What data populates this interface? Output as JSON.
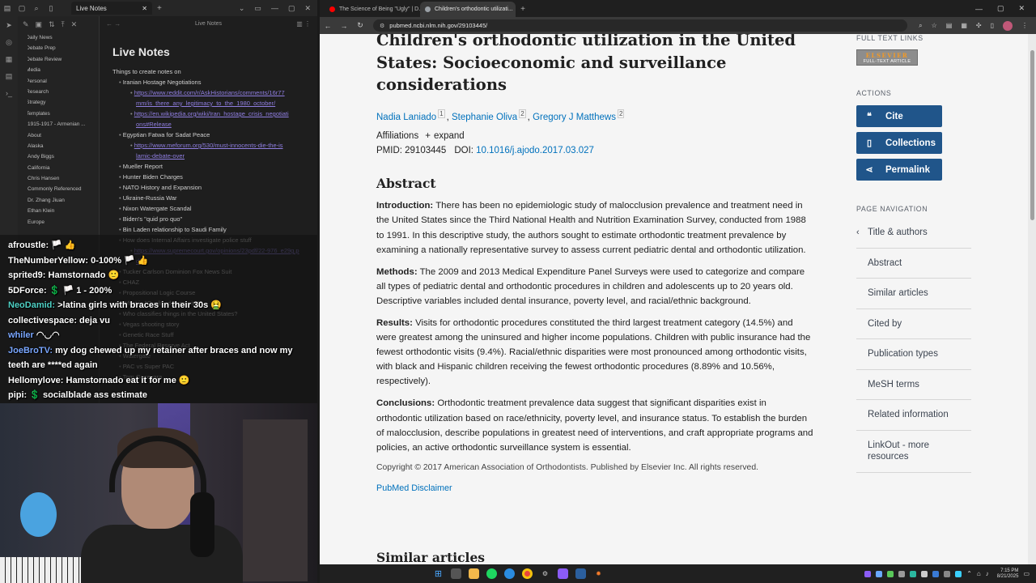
{
  "obsidian": {
    "tab_title": "Live Notes",
    "editor_header": "Live Notes",
    "note_title": "Live Notes",
    "tree": [
      {
        "label": "Daily News",
        "folder": true
      },
      {
        "label": "Debate Prep",
        "folder": true
      },
      {
        "label": "Debate Review",
        "folder": true
      },
      {
        "label": "Media",
        "folder": true
      },
      {
        "label": "Personal",
        "folder": true
      },
      {
        "label": "Research",
        "folder": true
      },
      {
        "label": "Strategy",
        "folder": true
      },
      {
        "label": "Templates",
        "folder": true
      },
      {
        "label": "1915-1917 - Armenian ...",
        "folder": false
      },
      {
        "label": "About",
        "folder": false
      },
      {
        "label": "Alaska",
        "folder": false
      },
      {
        "label": "Andy Biggs",
        "folder": false
      },
      {
        "label": "California",
        "folder": false
      },
      {
        "label": "Chris Hansen",
        "folder": false
      },
      {
        "label": "Commonly Referenced",
        "folder": false
      },
      {
        "label": "Dr. Zhang Jiuan",
        "folder": false
      },
      {
        "label": "Ethan Klein",
        "folder": false
      },
      {
        "label": "Europe",
        "folder": false
      }
    ],
    "lines": [
      {
        "level": 0,
        "text": "Things to create notes on"
      },
      {
        "level": 1,
        "text": "Iranian Hostage Negotiations"
      },
      {
        "level": 2,
        "text": "https://www.reddit.com/r/AskHistorians/comments/16r77",
        "link": true
      },
      {
        "level": 3,
        "text": "mm/is_there_any_legitimacy_to_the_1980_october/",
        "link": true
      },
      {
        "level": 2,
        "text": "https://en.wikipedia.org/wiki/Iran_hostage_crisis_negotiati",
        "link": true
      },
      {
        "level": 3,
        "text": "ons#Release",
        "link": true
      },
      {
        "level": 1,
        "text": "Egyptian Fatwa for Sadat Peace"
      },
      {
        "level": 2,
        "text": "https://www.meforum.org/530/must-innocents-die-the-is",
        "link": true
      },
      {
        "level": 3,
        "text": "lamic-debate-over",
        "link": true
      },
      {
        "level": 1,
        "text": "Mueller Report"
      },
      {
        "level": 1,
        "text": "Hunter Biden Charges"
      },
      {
        "level": 1,
        "text": "NATO History and Expansion"
      },
      {
        "level": 1,
        "text": "Ukraine-Russia War"
      },
      {
        "level": 1,
        "text": "Nixon Watergate Scandal"
      },
      {
        "level": 1,
        "text": "Biden's \"quid pro quo\""
      },
      {
        "level": 1,
        "text": "Bin Laden relationship to Saudi Family"
      },
      {
        "level": 1,
        "text": "How does Internal Affairs investigate police stuff"
      },
      {
        "level": 2,
        "text": "https://www.supremecourt.gov/opinions/23pdf/22-976_e29g.p",
        "link": true
      },
      {
        "level": 3,
        "text": "df",
        "link": true
      },
      {
        "level": 1,
        "text": "Tucker Carlson Dominion Fox News Suit"
      },
      {
        "level": 1,
        "text": "CHAZ"
      },
      {
        "level": 1,
        "text": "Propositional Logic Course"
      },
      {
        "level": 1,
        "text": "What is \"Qualified Immunity\"?"
      },
      {
        "level": 1,
        "text": "Who classifies things in the United States?"
      },
      {
        "level": 1,
        "text": "Vegas shooting story"
      },
      {
        "level": 1,
        "text": "Genetic Race Stuff"
      },
      {
        "level": 1,
        "text": "The Federal Reserve Act"
      },
      {
        "level": 1,
        "text": "Watergate"
      },
      {
        "level": 1,
        "text": "PAC vs Super PAC"
      },
      {
        "level": 1,
        "text": "Tom Gasevara"
      }
    ]
  },
  "chat": [
    {
      "user": "afroustle:",
      "msg": " 🏳️ 👍",
      "color": "white"
    },
    {
      "user": "TheNumberYellow:",
      "msg": " 0-100% 🏳️ 👍",
      "color": "white"
    },
    {
      "user": "sprited9:",
      "msg": " Hamstornado 🙂",
      "color": "white"
    },
    {
      "user": "5DForce:",
      "msg": " 💲 🏳️ 1 - 200%",
      "color": "white"
    },
    {
      "user": "NeoDamid:",
      "msg": " >latina girls with braces in their 30s 🤮",
      "color": "teal"
    },
    {
      "user": "collectivespace:",
      "msg": " deja vu",
      "color": "white"
    },
    {
      "user": "whiler",
      "msg": " ◠◡◠",
      "color": "blue"
    },
    {
      "user": "JoeBroTV:",
      "msg": " my dog chewed up my retainer after braces and now my",
      "color": "blue"
    },
    {
      "user": "",
      "msg": "teeth are ****ed again",
      "color": "white"
    },
    {
      "user": "Hellomylove:",
      "msg": " Hamstornado eat it for me 🙂",
      "color": "white"
    },
    {
      "user": "pipi:",
      "msg": " 💲 socialblade ass estimate",
      "color": "white"
    }
  ],
  "browser": {
    "tabs": [
      {
        "title": "The Science of Being \"Ugly\" | D...",
        "active": false,
        "fav_color": "#ff0000"
      },
      {
        "title": "Children's orthodontic utilizati...",
        "active": true,
        "fav_color": "#9aa0a6"
      }
    ],
    "url": "pubmed.ncbi.nlm.nih.gov/29103445/"
  },
  "article": {
    "title": "Children's orthodontic utilization in the United States: Socioeconomic and surveillance considerations",
    "authors": [
      {
        "name": "Nadia Laniado",
        "sup": "1"
      },
      {
        "name": "Stephanie Oliva",
        "sup": "2"
      },
      {
        "name": "Gregory J Matthews",
        "sup": "2"
      }
    ],
    "affiliations_label": "Affiliations",
    "expand_label": "expand",
    "pmid": "PMID: 29103445",
    "doi_label": "DOI:",
    "doi": "10.1016/j.ajodo.2017.03.027",
    "abstract_heading": "Abstract",
    "sections": [
      {
        "label": "Introduction:",
        "text": " There has been no epidemiologic study of malocclusion prevalence and treatment need in the United States since the Third National Health and Nutrition Examination Survey, conducted from 1988 to 1991. In this descriptive study, the authors sought to estimate orthodontic treatment prevalence by examining a nationally representative survey to assess current pediatric dental and orthodontic utilization."
      },
      {
        "label": "Methods:",
        "text": " The 2009 and 2013 Medical Expenditure Panel Surveys were used to categorize and compare all types of pediatric dental and orthodontic procedures in children and adolescents up to 20 years old. Descriptive variables included dental insurance, poverty level, and racial/ethnic background."
      },
      {
        "label": "Results:",
        "text": " Visits for orthodontic procedures constituted the third largest treatment category (14.5%) and were greatest among the uninsured and higher income populations. Children with public insurance had the fewest orthodontic visits (9.4%). Racial/ethnic disparities were most pronounced among orthodontic visits, with black and Hispanic children receiving the fewest orthodontic procedures (8.89% and 10.56%, respectively)."
      },
      {
        "label": "Conclusions:",
        "text": " Orthodontic treatment prevalence data suggest that significant disparities exist in orthodontic utilization based on race/ethnicity, poverty level, and insurance status. To establish the burden of malocclusion, describe populations in greatest need of interventions, and craft appropriate programs and policies, an active orthodontic surveillance system is essential."
      }
    ],
    "copyright": "Copyright © 2017 American Association of Orthodontists. Published by Elsevier Inc. All rights reserved.",
    "disclaimer": "PubMed Disclaimer",
    "similar_heading": "Similar articles"
  },
  "aside": {
    "full_text_heading": "FULL TEXT LINKS",
    "elsevier_logo": "ELSEVIER",
    "elsevier_sub": "FULL-TEXT ARTICLE",
    "actions_heading": "ACTIONS",
    "cite": "Cite",
    "collections": "Collections",
    "permalink": "Permalink",
    "page_nav_heading": "PAGE NAVIGATION",
    "nav": [
      "Title & authors",
      "Abstract",
      "Similar articles",
      "Cited by",
      "Publication types",
      "MeSH terms",
      "Related information",
      "LinkOut - more resources"
    ]
  },
  "taskbar": {
    "time": "7:15 PM",
    "date": "8/21/2025"
  },
  "colors": {
    "link": "#0071bc",
    "action_button": "#20558a",
    "obsidian_link": "#8f7ee0"
  }
}
